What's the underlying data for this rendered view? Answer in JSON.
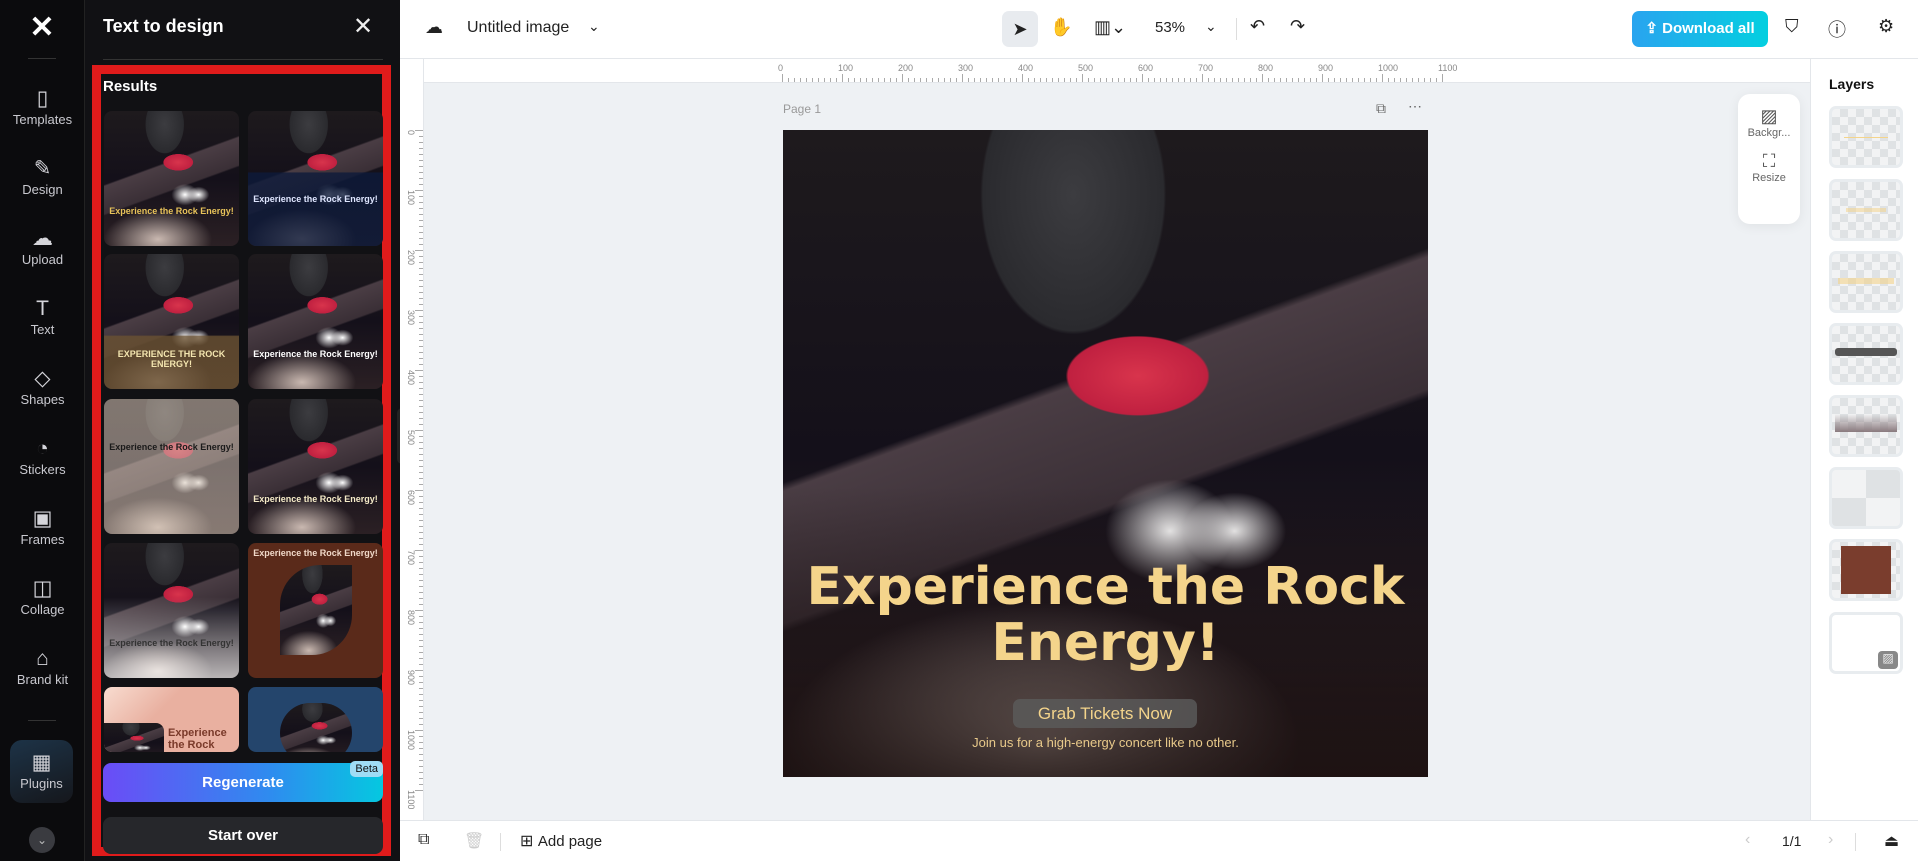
{
  "rail": {
    "items": [
      {
        "label": "Templates",
        "icon": "templates-icon",
        "glyph": "▯"
      },
      {
        "label": "Design",
        "icon": "design-icon",
        "glyph": "✎"
      },
      {
        "label": "Upload",
        "icon": "upload-cloud-icon",
        "glyph": "☁"
      },
      {
        "label": "Text",
        "icon": "text-icon",
        "glyph": "T"
      },
      {
        "label": "Shapes",
        "icon": "shapes-icon",
        "glyph": "◇"
      },
      {
        "label": "Stickers",
        "icon": "stickers-icon",
        "glyph": "◔"
      },
      {
        "label": "Frames",
        "icon": "frames-icon",
        "glyph": "▣"
      },
      {
        "label": "Collage",
        "icon": "collage-icon",
        "glyph": "◫"
      },
      {
        "label": "Brand kit",
        "icon": "brand-kit-icon",
        "glyph": "⌂"
      }
    ],
    "plugins": {
      "label": "Plugins",
      "glyph": "▦"
    },
    "more_glyph": "⌄",
    "logo": "⌘"
  },
  "panel": {
    "title": "Text to design",
    "close": "✕",
    "results": "Results",
    "thumbnails": [
      {
        "title": "Experience the Rock Energy!",
        "color": "#e8c35a",
        "style": "photo"
      },
      {
        "title": "Experience the Rock Energy!",
        "color": "#dfe6ff",
        "style": "photo-navy"
      },
      {
        "title": "EXPERIENCE THE ROCK ENERGY!",
        "color": "#f4e6b0",
        "style": "photo-brown"
      },
      {
        "title": "Experience the Rock Energy!",
        "color": "#ffffff",
        "style": "photo"
      },
      {
        "title": "Experience the Rock Energy!",
        "color": "#1a1a1a",
        "style": "photo-light"
      },
      {
        "title": "Experience the Rock Energy!",
        "color": "#f5ebc8",
        "style": "photo"
      },
      {
        "title": "Experience the Rock Energy!",
        "color": "#333",
        "style": "photo-fade"
      },
      {
        "title": "Experience the Rock Energy!",
        "color": "#f0d8c8",
        "style": "brown"
      },
      {
        "title": "Experience the Rock Energy!",
        "color": "#7a3a2a",
        "style": "pink"
      },
      {
        "title": "",
        "color": "#fff",
        "style": "blue"
      }
    ],
    "regenerate": "Regenerate",
    "beta": "Beta",
    "start_over": "Start over"
  },
  "topbar": {
    "title": "Untitled image",
    "zoom": "53%",
    "download": "Download all"
  },
  "ruler": {
    "labels": [
      "0",
      "100",
      "200",
      "300",
      "400",
      "500",
      "600",
      "700",
      "800",
      "900",
      "1000",
      "1100"
    ]
  },
  "canvas": {
    "page_label": "Page 1",
    "headline": "Experience the Rock Energy!",
    "button": "Grab Tickets Now",
    "tagline": "Join us for a high-energy concert like no other.",
    "accent": "#f4d48b"
  },
  "float_tools": [
    {
      "label": "Backgr...",
      "glyph": "▨"
    },
    {
      "label": "Resize",
      "glyph": "⛶"
    }
  ],
  "layers": {
    "title": "Layers"
  },
  "bottom": {
    "add_page": "Add page",
    "pagination": "1/1"
  }
}
